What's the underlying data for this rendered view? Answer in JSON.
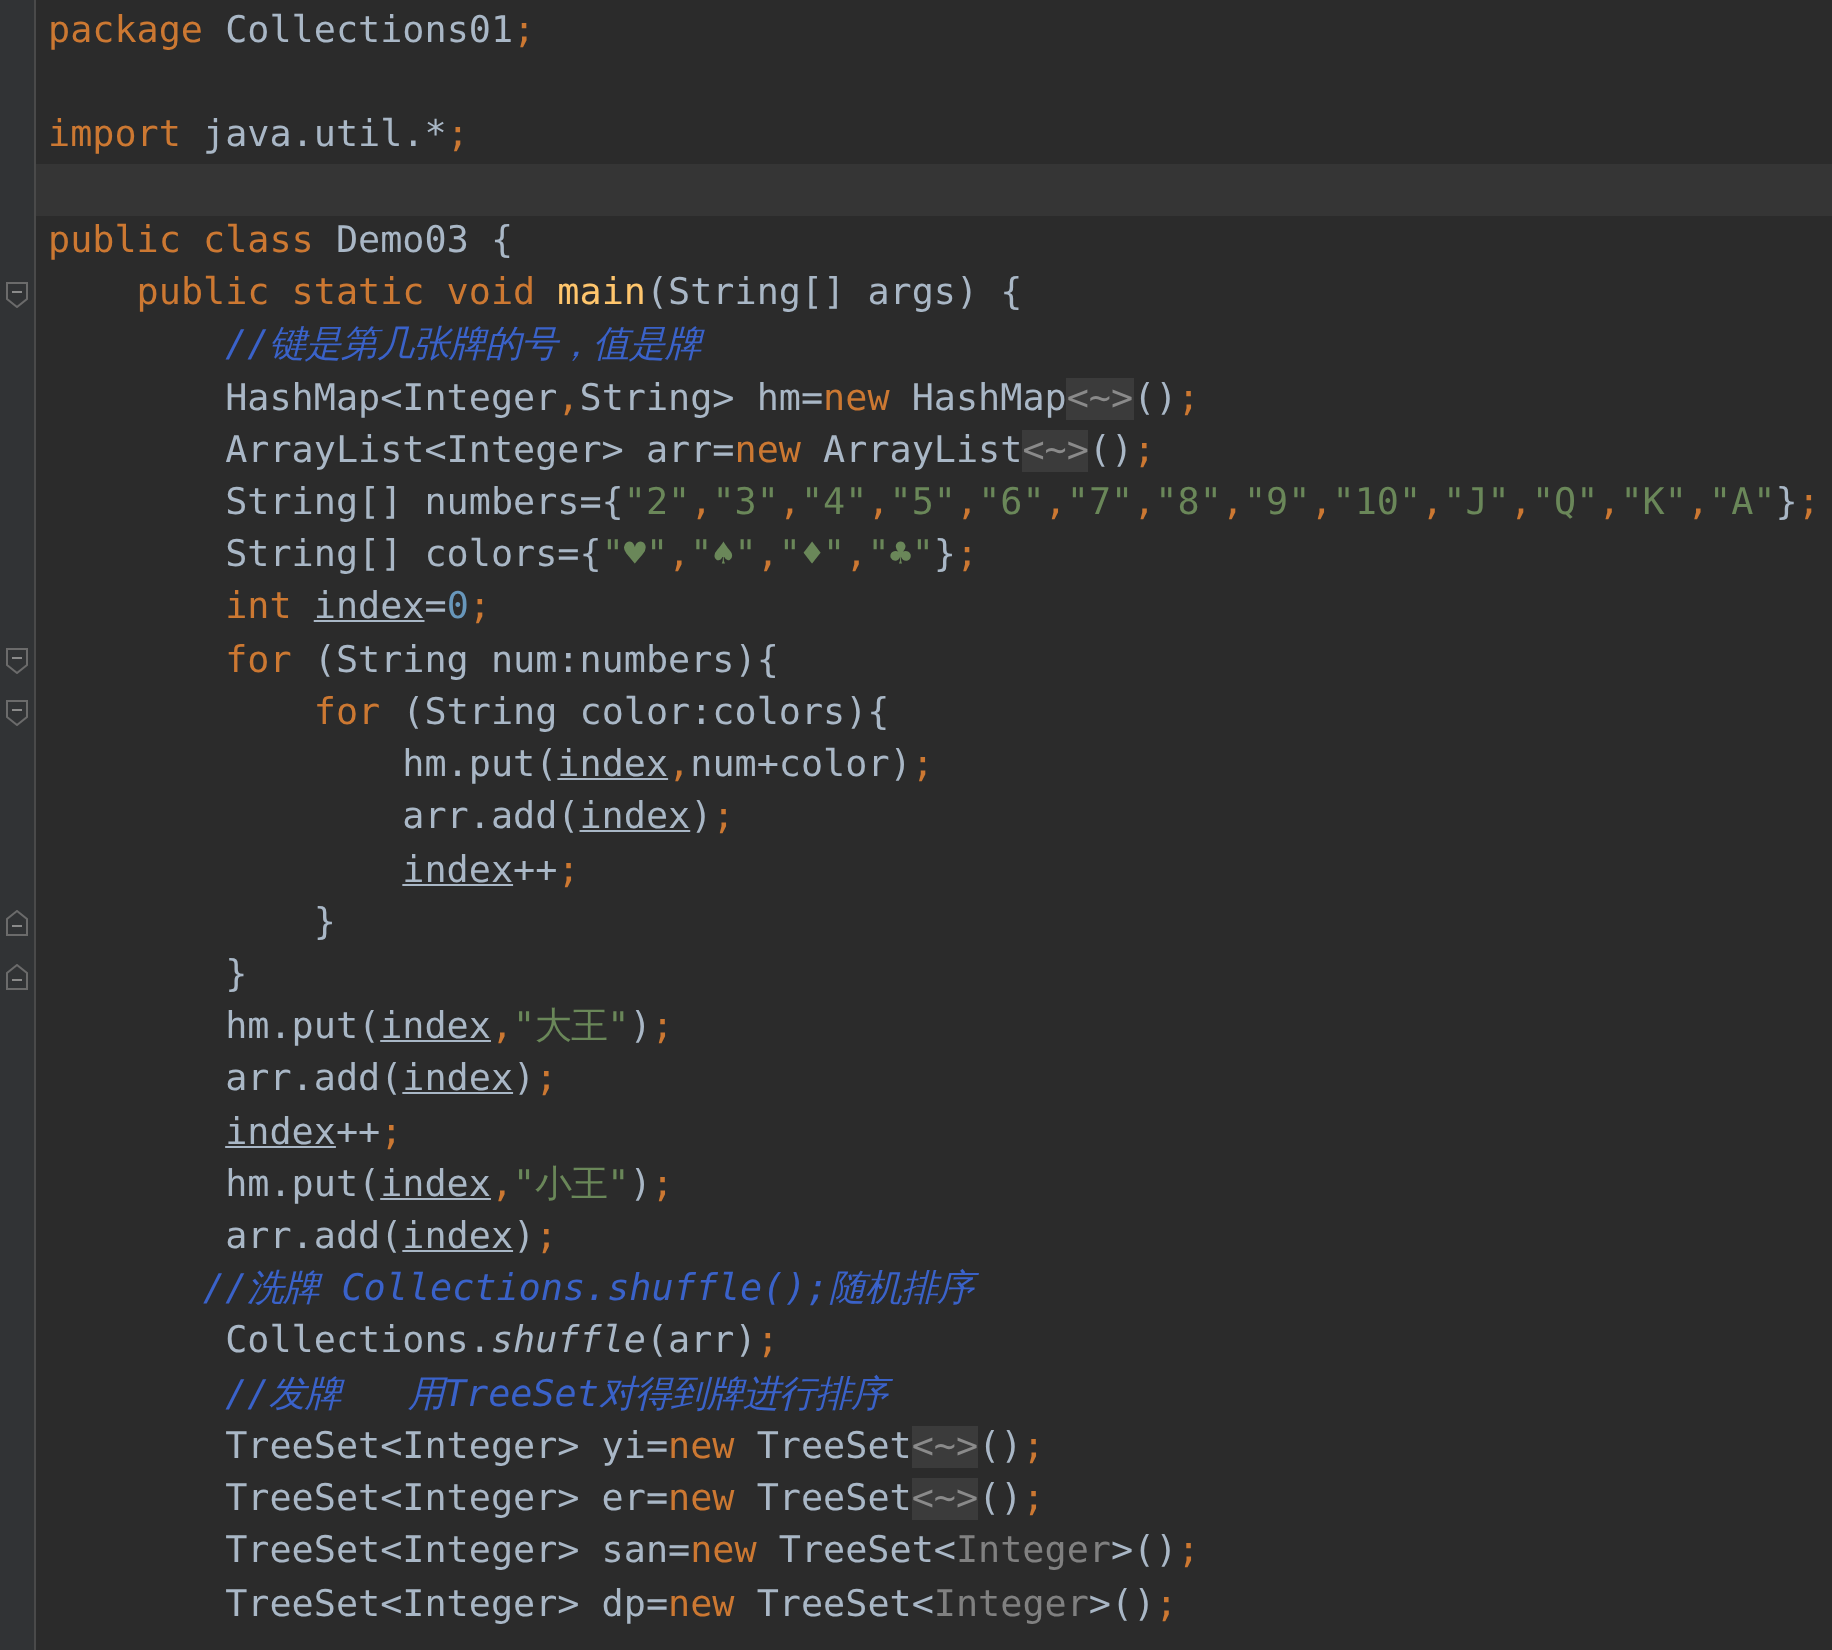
{
  "editor": {
    "lines": [
      {
        "kind": "code",
        "tokens": [
          {
            "text": "package",
            "kind": "kw"
          },
          {
            "text": " Collections01",
            "kind": "plain"
          },
          {
            "text": ";",
            "kind": "punct"
          }
        ]
      },
      {
        "kind": "code"
      },
      {
        "kind": "code",
        "tokens": [
          {
            "text": "import",
            "kind": "kw"
          },
          {
            "text": " java.util.*",
            "kind": "plain"
          },
          {
            "text": ";",
            "kind": "punct"
          }
        ]
      },
      {
        "kind": "current-line"
      },
      {
        "kind": "code",
        "tokens": [
          {
            "text": "public class",
            "kind": "kw"
          },
          {
            "text": " Demo03 {",
            "kind": "plain"
          }
        ]
      },
      {
        "kind": "fold-start",
        "tokens": [
          {
            "text": "    public static void ",
            "kind": "kw"
          },
          {
            "text": "main",
            "kind": "fn"
          },
          {
            "text": "(String[] args) {",
            "kind": "plain"
          }
        ]
      },
      {
        "kind": "code",
        "tokens": [
          {
            "text": "        //键是第几张牌的号，值是牌",
            "kind": "cmt"
          }
        ]
      },
      {
        "kind": "code",
        "tokens": [
          {
            "text": "        HashMap<Integer",
            "kind": "plain"
          },
          {
            "text": ",",
            "kind": "punct"
          },
          {
            "text": "String> hm=",
            "kind": "plain"
          },
          {
            "text": "new",
            "kind": "kw"
          },
          {
            "text": " HashMap",
            "kind": "plain"
          },
          {
            "text": "<~>",
            "kind": "fold"
          },
          {
            "text": "()",
            "kind": "plain"
          },
          {
            "text": ";",
            "kind": "punct"
          }
        ]
      },
      {
        "kind": "code",
        "tokens": [
          {
            "text": "        ArrayList<Integer> arr=",
            "kind": "plain"
          },
          {
            "text": "new",
            "kind": "kw"
          },
          {
            "text": " ArrayList",
            "kind": "plain"
          },
          {
            "text": "<~>",
            "kind": "fold"
          },
          {
            "text": "()",
            "kind": "plain"
          },
          {
            "text": ";",
            "kind": "punct"
          }
        ]
      },
      {
        "kind": "code",
        "tokens": [
          {
            "text": "        String[] numbers={",
            "kind": "plain"
          },
          {
            "text": "\"2\"",
            "kind": "str"
          },
          {
            "text": ",",
            "kind": "punct"
          },
          {
            "text": "\"3\"",
            "kind": "str"
          },
          {
            "text": ",",
            "kind": "punct"
          },
          {
            "text": "\"4\"",
            "kind": "str"
          },
          {
            "text": ",",
            "kind": "punct"
          },
          {
            "text": "\"5\"",
            "kind": "str"
          },
          {
            "text": ",",
            "kind": "punct"
          },
          {
            "text": "\"6\"",
            "kind": "str"
          },
          {
            "text": ",",
            "kind": "punct"
          },
          {
            "text": "\"7\"",
            "kind": "str"
          },
          {
            "text": ",",
            "kind": "punct"
          },
          {
            "text": "\"8\"",
            "kind": "str"
          },
          {
            "text": ",",
            "kind": "punct"
          },
          {
            "text": "\"9\"",
            "kind": "str"
          },
          {
            "text": ",",
            "kind": "punct"
          },
          {
            "text": "\"10\"",
            "kind": "str"
          },
          {
            "text": ",",
            "kind": "punct"
          },
          {
            "text": "\"J\"",
            "kind": "str"
          },
          {
            "text": ",",
            "kind": "punct"
          },
          {
            "text": "\"Q\"",
            "kind": "str"
          },
          {
            "text": ",",
            "kind": "punct"
          },
          {
            "text": "\"K\"",
            "kind": "str"
          },
          {
            "text": ",",
            "kind": "punct"
          },
          {
            "text": "\"A\"",
            "kind": "str"
          },
          {
            "text": "}",
            "kind": "plain"
          },
          {
            "text": ";",
            "kind": "punct"
          }
        ]
      },
      {
        "kind": "code",
        "tokens": [
          {
            "text": "        String[] colors={",
            "kind": "plain"
          },
          {
            "text": "\"♥\"",
            "kind": "str"
          },
          {
            "text": ",",
            "kind": "punct"
          },
          {
            "text": "\"♠\"",
            "kind": "str"
          },
          {
            "text": ",",
            "kind": "punct"
          },
          {
            "text": "\"♦\"",
            "kind": "str"
          },
          {
            "text": ",",
            "kind": "punct"
          },
          {
            "text": "\"♣\"",
            "kind": "str"
          },
          {
            "text": "}",
            "kind": "plain"
          },
          {
            "text": ";",
            "kind": "punct"
          }
        ]
      },
      {
        "kind": "code",
        "tokens": [
          {
            "text": "        int ",
            "kind": "kw"
          },
          {
            "text": "index",
            "kind": "var"
          },
          {
            "text": "=",
            "kind": "plain"
          },
          {
            "text": "0",
            "kind": "num"
          },
          {
            "text": ";",
            "kind": "punct"
          }
        ]
      },
      {
        "kind": "fold-start",
        "tokens": [
          {
            "text": "        for",
            "kind": "kw"
          },
          {
            "text": " (String num:numbers){",
            "kind": "plain"
          }
        ]
      },
      {
        "kind": "fold-start",
        "tokens": [
          {
            "text": "            for",
            "kind": "kw"
          },
          {
            "text": " (String color:colors){",
            "kind": "plain"
          }
        ]
      },
      {
        "kind": "code",
        "tokens": [
          {
            "text": "                hm.put(",
            "kind": "plain"
          },
          {
            "text": "index",
            "kind": "var"
          },
          {
            "text": ",",
            "kind": "punct"
          },
          {
            "text": "num+color)",
            "kind": "plain"
          },
          {
            "text": ";",
            "kind": "punct"
          }
        ]
      },
      {
        "kind": "code",
        "tokens": [
          {
            "text": "                arr.add(",
            "kind": "plain"
          },
          {
            "text": "index",
            "kind": "var"
          },
          {
            "text": ")",
            "kind": "plain"
          },
          {
            "text": ";",
            "kind": "punct"
          }
        ]
      },
      {
        "kind": "code",
        "tokens": [
          {
            "text": "                index",
            "kind": "var"
          },
          {
            "text": "++",
            "kind": "plain"
          },
          {
            "text": ";",
            "kind": "punct"
          }
        ]
      },
      {
        "kind": "fold-end",
        "tokens": [
          {
            "text": "            }",
            "kind": "plain"
          }
        ]
      },
      {
        "kind": "fold-end",
        "tokens": [
          {
            "text": "        }",
            "kind": "plain"
          }
        ]
      },
      {
        "kind": "code",
        "tokens": [
          {
            "text": "        hm.put(",
            "kind": "plain"
          },
          {
            "text": "index",
            "kind": "var"
          },
          {
            "text": ",",
            "kind": "punct"
          },
          {
            "text": "\"大王\"",
            "kind": "str"
          },
          {
            "text": ")",
            "kind": "plain"
          },
          {
            "text": ";",
            "kind": "punct"
          }
        ]
      },
      {
        "kind": "code",
        "tokens": [
          {
            "text": "        arr.add(",
            "kind": "plain"
          },
          {
            "text": "index",
            "kind": "var"
          },
          {
            "text": ")",
            "kind": "plain"
          },
          {
            "text": ";",
            "kind": "punct"
          }
        ]
      },
      {
        "kind": "code",
        "tokens": [
          {
            "text": "        index",
            "kind": "var"
          },
          {
            "text": "++",
            "kind": "plain"
          },
          {
            "text": ";",
            "kind": "punct"
          }
        ]
      },
      {
        "kind": "code",
        "tokens": [
          {
            "text": "        hm.put(",
            "kind": "plain"
          },
          {
            "text": "index",
            "kind": "var"
          },
          {
            "text": ",",
            "kind": "punct"
          },
          {
            "text": "\"小王\"",
            "kind": "str"
          },
          {
            "text": ")",
            "kind": "plain"
          },
          {
            "text": ";",
            "kind": "punct"
          }
        ]
      },
      {
        "kind": "code",
        "tokens": [
          {
            "text": "        arr.add(",
            "kind": "plain"
          },
          {
            "text": "index",
            "kind": "var"
          },
          {
            "text": ")",
            "kind": "plain"
          },
          {
            "text": ";",
            "kind": "punct"
          }
        ]
      },
      {
        "kind": "code",
        "tokens": [
          {
            "text": "       //洗牌 Collections.shuffle();随机排序",
            "kind": "cmt"
          }
        ]
      },
      {
        "kind": "code",
        "tokens": [
          {
            "text": "        Collections.",
            "kind": "plain"
          },
          {
            "text": "shuffle",
            "kind": "ital"
          },
          {
            "text": "(arr)",
            "kind": "plain"
          },
          {
            "text": ";",
            "kind": "punct"
          }
        ]
      },
      {
        "kind": "code",
        "tokens": [
          {
            "text": "        //发牌   用TreeSet对得到牌进行排序",
            "kind": "cmt"
          }
        ]
      },
      {
        "kind": "code",
        "tokens": [
          {
            "text": "        TreeSet<Integer> yi=",
            "kind": "plain"
          },
          {
            "text": "new",
            "kind": "kw"
          },
          {
            "text": " TreeSet",
            "kind": "plain"
          },
          {
            "text": "<~>",
            "kind": "fold"
          },
          {
            "text": "()",
            "kind": "plain"
          },
          {
            "text": ";",
            "kind": "punct"
          }
        ]
      },
      {
        "kind": "code",
        "tokens": [
          {
            "text": "        TreeSet<Integer> er=",
            "kind": "plain"
          },
          {
            "text": "new",
            "kind": "kw"
          },
          {
            "text": " TreeSet",
            "kind": "plain"
          },
          {
            "text": "<~>",
            "kind": "fold"
          },
          {
            "text": "()",
            "kind": "plain"
          },
          {
            "text": ";",
            "kind": "punct"
          }
        ]
      },
      {
        "kind": "code",
        "tokens": [
          {
            "text": "        TreeSet<Integer> san=",
            "kind": "plain"
          },
          {
            "text": "new",
            "kind": "kw"
          },
          {
            "text": " TreeSet<",
            "kind": "plain"
          },
          {
            "text": "Integer",
            "kind": "gen"
          },
          {
            "text": ">()",
            "kind": "plain"
          },
          {
            "text": ";",
            "kind": "punct"
          }
        ]
      },
      {
        "kind": "code",
        "tokens": [
          {
            "text": "        TreeSet<Integer> dp=",
            "kind": "plain"
          },
          {
            "text": "new",
            "kind": "kw"
          },
          {
            "text": " TreeSet<",
            "kind": "plain"
          },
          {
            "text": "Integer",
            "kind": "gen"
          },
          {
            "text": ">()",
            "kind": "plain"
          },
          {
            "text": ";",
            "kind": "punct"
          }
        ]
      }
    ]
  }
}
